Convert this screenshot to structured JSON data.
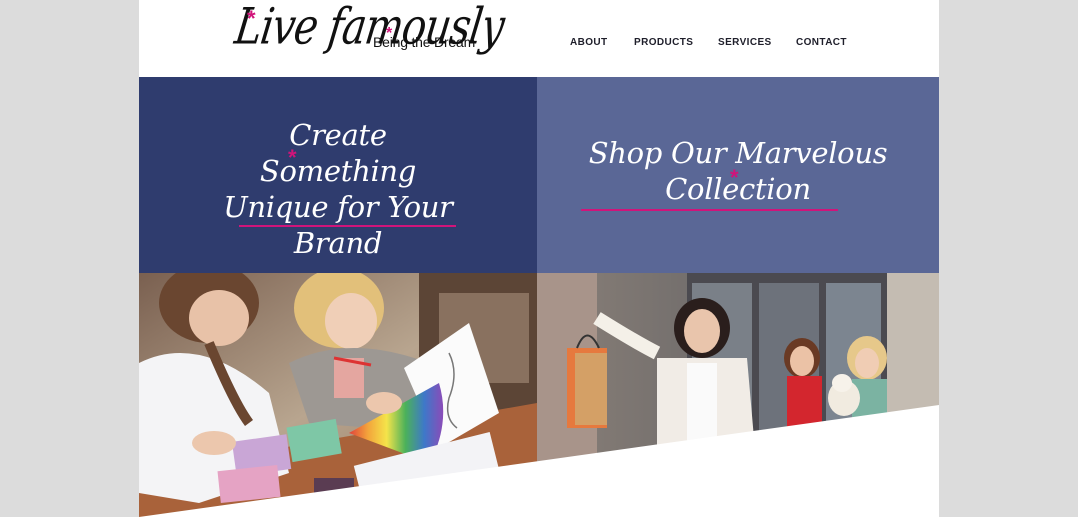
{
  "brand": {
    "logo_text": "Live famously",
    "tagline": "Being the Dream"
  },
  "nav": {
    "items": [
      "ABOUT",
      "PRODUCTS",
      "SERVICES",
      "CONTACT"
    ]
  },
  "panels": {
    "left": {
      "title_lines": [
        "Create Something",
        "Unique for Your",
        "Brand"
      ]
    },
    "right": {
      "title_lines": [
        "Shop Our Marvelous",
        "Collection"
      ]
    }
  },
  "colors": {
    "accent": "#d1147a",
    "panel_left": "#2f3c6e",
    "panel_right": "#5a6796",
    "page_bg": "#dcdcdc"
  },
  "images": {
    "left": "photo-designers-color-swatches",
    "right": "photo-women-shopping-bags"
  }
}
